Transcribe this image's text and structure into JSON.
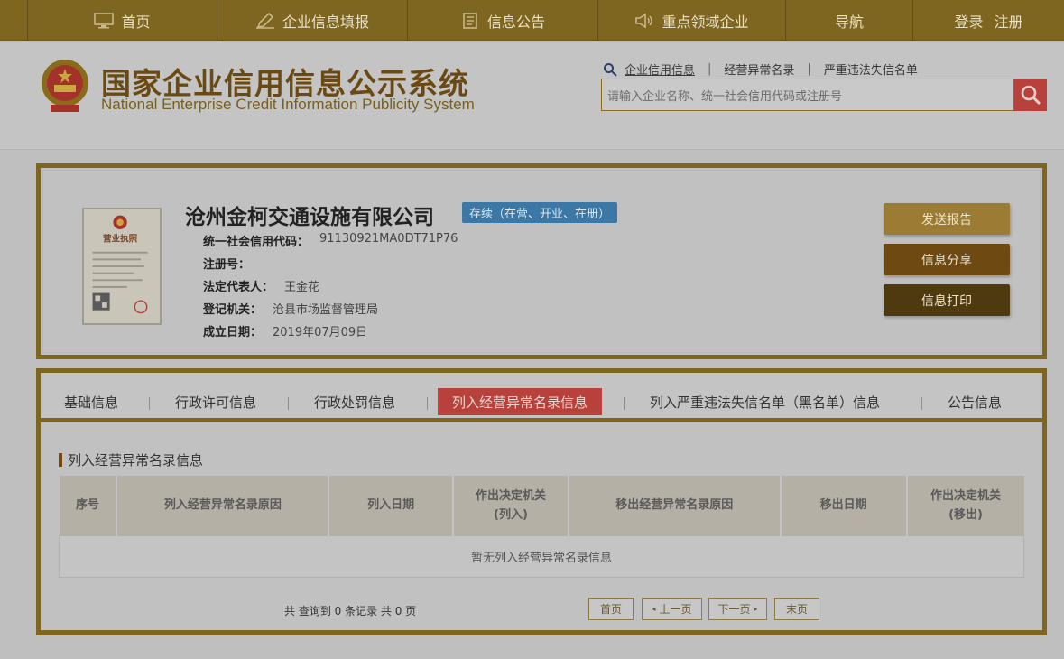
{
  "topnav": {
    "items": [
      {
        "label": "首页",
        "icon": "monitor-icon"
      },
      {
        "label": "企业信息填报",
        "icon": "pen-icon"
      },
      {
        "label": "信息公告",
        "icon": "document-icon"
      },
      {
        "label": "重点领域企业",
        "icon": "speaker-icon"
      },
      {
        "label": "导航",
        "icon": ""
      }
    ],
    "login": "登录",
    "register": "注册"
  },
  "header": {
    "title_cn": "国家企业信用信息公示系统",
    "title_en": "National Enterprise Credit Information Publicity System",
    "quick_links": [
      "企业信用信息",
      "经营异常名录",
      "严重违法失信名单"
    ],
    "search_placeholder": "请输入企业名称、统一社会信用代码或注册号"
  },
  "company": {
    "name": "沧州金柯交通设施有限公司",
    "status": "存续（在营、开业、在册）",
    "license_heading": "营业执照",
    "fields": [
      {
        "label": "统一社会信用代码：",
        "value": "91130921MA0DT71P76"
      },
      {
        "label": "注册号：",
        "value": ""
      },
      {
        "label": "法定代表人：",
        "value": "王金花"
      },
      {
        "label": "登记机关：",
        "value": "沧县市场监督管理局"
      },
      {
        "label": "成立日期：",
        "value": "2019年07月09日"
      }
    ],
    "buttons": {
      "send": "发送报告",
      "share": "信息分享",
      "print": "信息打印"
    }
  },
  "tabs": [
    {
      "label": "基础信息"
    },
    {
      "label": "行政许可信息"
    },
    {
      "label": "行政处罚信息"
    },
    {
      "label": "列入经营异常名录信息",
      "active": true
    },
    {
      "label": "列入严重违法失信名单（黑名单）信息"
    },
    {
      "label": "公告信息"
    }
  ],
  "section": {
    "title": "列入经营异常名录信息",
    "columns": [
      "序号",
      "列入经营异常名录原因",
      "列入日期",
      "作出决定机关\n(列入)",
      "移出经营异常名录原因",
      "移出日期",
      "作出决定机关\n(移出)"
    ],
    "empty_message": "暂无列入经营异常名录信息",
    "record_count": "共 查询到 0 条记录 共 0 页",
    "pager": {
      "first": "首页",
      "prev": "上一页",
      "next": "下一页",
      "last": "末页"
    }
  },
  "colors": {
    "brand": "#7e6620",
    "accent_red": "#b8413c",
    "badge_blue": "#3b78a5"
  }
}
